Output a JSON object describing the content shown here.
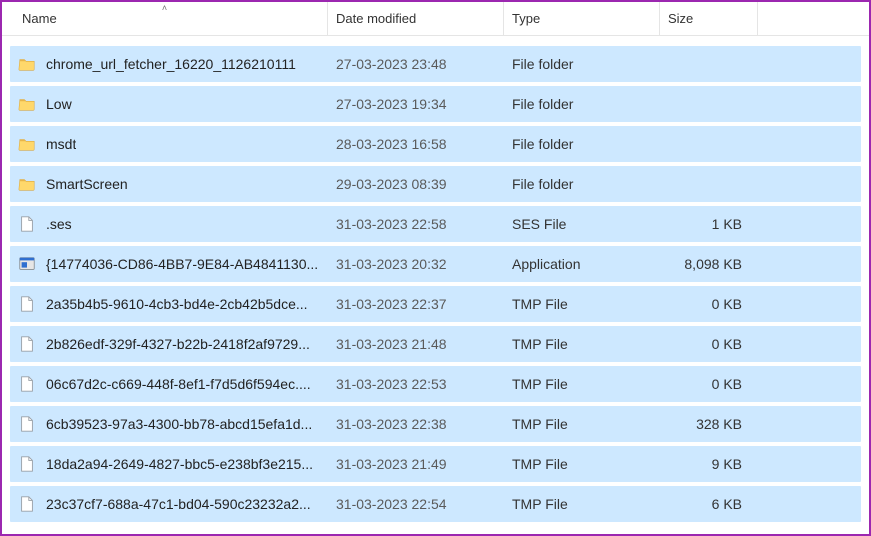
{
  "columns": {
    "name": "Name",
    "date": "Date modified",
    "type": "Type",
    "size": "Size"
  },
  "sort": {
    "column": "name",
    "direction": "asc"
  },
  "icons": {
    "folder": "folder-icon",
    "file": "file-icon",
    "app": "app-icon"
  },
  "rows": [
    {
      "icon": "folder",
      "name": "chrome_url_fetcher_16220_1126210111",
      "date": "27-03-2023 23:48",
      "type": "File folder",
      "size": ""
    },
    {
      "icon": "folder",
      "name": "Low",
      "date": "27-03-2023 19:34",
      "type": "File folder",
      "size": ""
    },
    {
      "icon": "folder",
      "name": "msdt",
      "date": "28-03-2023 16:58",
      "type": "File folder",
      "size": ""
    },
    {
      "icon": "folder",
      "name": "SmartScreen",
      "date": "29-03-2023 08:39",
      "type": "File folder",
      "size": ""
    },
    {
      "icon": "file",
      "name": ".ses",
      "date": "31-03-2023 22:58",
      "type": "SES File",
      "size": "1 KB"
    },
    {
      "icon": "app",
      "name": "{14774036-CD86-4BB7-9E84-AB4841130...",
      "date": "31-03-2023 20:32",
      "type": "Application",
      "size": "8,098 KB"
    },
    {
      "icon": "file",
      "name": "2a35b4b5-9610-4cb3-bd4e-2cb42b5dce...",
      "date": "31-03-2023 22:37",
      "type": "TMP File",
      "size": "0 KB"
    },
    {
      "icon": "file",
      "name": "2b826edf-329f-4327-b22b-2418f2af9729...",
      "date": "31-03-2023 21:48",
      "type": "TMP File",
      "size": "0 KB"
    },
    {
      "icon": "file",
      "name": "06c67d2c-c669-448f-8ef1-f7d5d6f594ec....",
      "date": "31-03-2023 22:53",
      "type": "TMP File",
      "size": "0 KB"
    },
    {
      "icon": "file",
      "name": "6cb39523-97a3-4300-bb78-abcd15efa1d...",
      "date": "31-03-2023 22:38",
      "type": "TMP File",
      "size": "328 KB"
    },
    {
      "icon": "file",
      "name": "18da2a94-2649-4827-bbc5-e238bf3e215...",
      "date": "31-03-2023 21:49",
      "type": "TMP File",
      "size": "9 KB"
    },
    {
      "icon": "file",
      "name": "23c37cf7-688a-47c1-bd04-590c23232a2...",
      "date": "31-03-2023 22:54",
      "type": "TMP File",
      "size": "6 KB"
    }
  ]
}
